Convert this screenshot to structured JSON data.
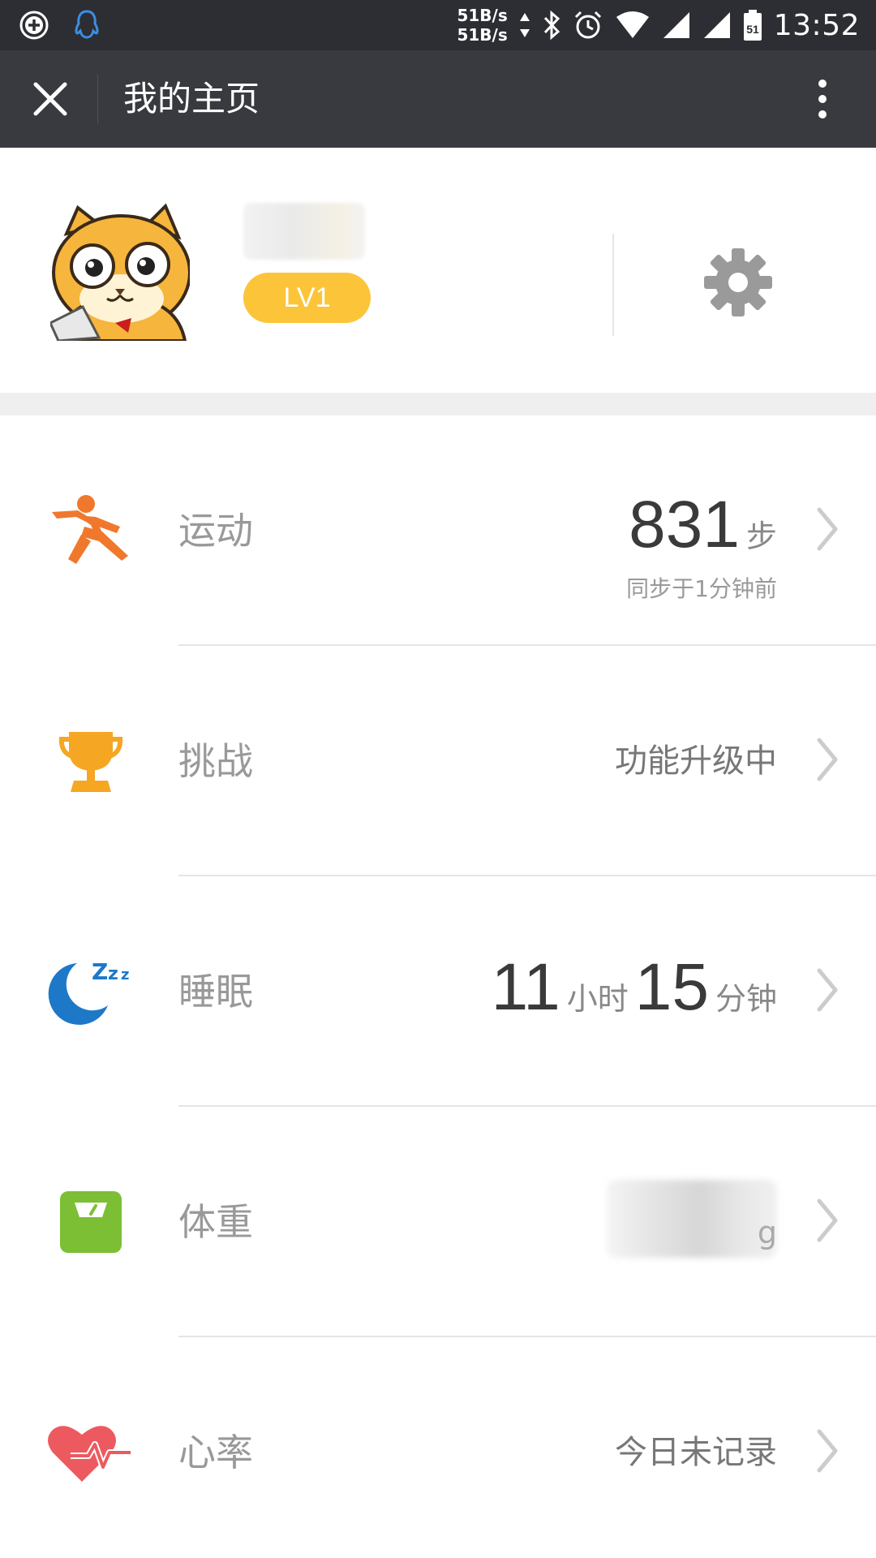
{
  "status_bar": {
    "net_up": "51B/s",
    "net_down": "51B/s",
    "sim_label": "51",
    "time": "13:52",
    "icons": [
      "add-circle-icon",
      "qq-penguin-icon",
      "bluetooth-icon",
      "alarm-icon",
      "wifi-icon",
      "signal-icon",
      "battery-icon"
    ]
  },
  "nav": {
    "title": "我的主页",
    "close_icon": "close-icon",
    "more_icon": "more-vertical-icon"
  },
  "profile": {
    "username": "",
    "level": "LV1",
    "settings_icon": "gear-icon"
  },
  "metrics": [
    {
      "id": "exercise",
      "icon": "running-person-icon",
      "label": "运动",
      "value": "831",
      "unit": "步",
      "sub": "同步于1分钟前"
    },
    {
      "id": "challenge",
      "icon": "trophy-icon",
      "label": "挑战",
      "status": "功能升级中"
    },
    {
      "id": "sleep",
      "icon": "moon-zzz-icon",
      "label": "睡眠",
      "hours": "11",
      "hours_unit": "小时",
      "minutes": "15",
      "minutes_unit": "分钟"
    },
    {
      "id": "weight",
      "icon": "scale-icon",
      "label": "体重",
      "unit": "g"
    },
    {
      "id": "heart-rate",
      "icon": "heart-pulse-icon",
      "label": "心率",
      "status": "今日未记录"
    }
  ],
  "colors": {
    "status_bar_bg": "#2d2e33",
    "nav_bg": "#393a3f",
    "level_badge": "#fcc438",
    "exercise_icon": "#f0782d",
    "trophy_icon": "#f5a623",
    "sleep_icon": "#1e78c8",
    "scale_icon": "#7cbf35",
    "heart_icon": "#ec5a60"
  }
}
